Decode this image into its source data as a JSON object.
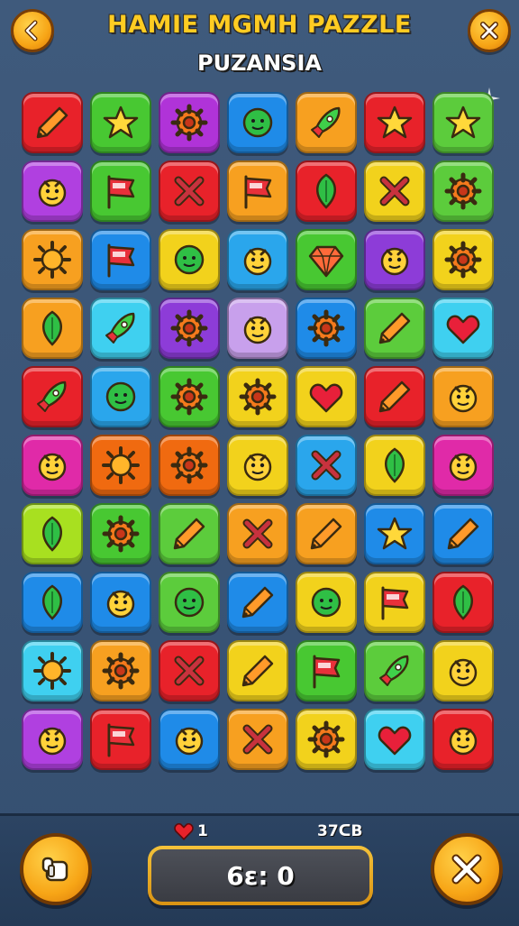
{
  "header": {
    "title": "HAMIE MGMH PAZZLE",
    "subtitle": "PUZANSIA",
    "back_icon": "chevron-left-icon",
    "close_icon": "close-icon"
  },
  "board": {
    "rows": 10,
    "cols": 7,
    "tiles": [
      [
        [
          "#e8222a",
          "crayon"
        ],
        [
          "#48c832",
          "star"
        ],
        [
          "#b033d8",
          "gear"
        ],
        [
          "#1f8be8",
          "blob"
        ],
        [
          "#f7a020",
          "rocket"
        ],
        [
          "#e8222a",
          "star"
        ],
        [
          "#5ccc3c",
          "star"
        ]
      ],
      [
        [
          "#b040e0",
          "creature"
        ],
        [
          "#48c832",
          "flag"
        ],
        [
          "#e8222a",
          "cross"
        ],
        [
          "#f7a020",
          "flag"
        ],
        [
          "#e8222a",
          "leaf"
        ],
        [
          "#f2d21c",
          "cross"
        ],
        [
          "#5ccc3c",
          "gear"
        ]
      ],
      [
        [
          "#f7a020",
          "sun"
        ],
        [
          "#1f8be8",
          "flag"
        ],
        [
          "#f2d21c",
          "blob"
        ],
        [
          "#2aa6ec",
          "creature"
        ],
        [
          "#48c832",
          "gem"
        ],
        [
          "#8d3cd8",
          "creature"
        ],
        [
          "#f2d21c",
          "gear"
        ]
      ],
      [
        [
          "#f7a020",
          "leaf"
        ],
        [
          "#3fd0f0",
          "rocket"
        ],
        [
          "#8d3cd8",
          "gear"
        ],
        [
          "#c8a0ec",
          "creature"
        ],
        [
          "#1f8be8",
          "gear"
        ],
        [
          "#5ccc3c",
          "crayon"
        ],
        [
          "#3fd0f0",
          "heart"
        ]
      ],
      [
        [
          "#e8222a",
          "rocket"
        ],
        [
          "#2aa6ec",
          "blob"
        ],
        [
          "#48c832",
          "gear"
        ],
        [
          "#f2d21c",
          "gear"
        ],
        [
          "#f2d21c",
          "heart"
        ],
        [
          "#e8222a",
          "crayon"
        ],
        [
          "#f7a020",
          "creature"
        ]
      ],
      [
        [
          "#e02aa8",
          "creature"
        ],
        [
          "#f06a10",
          "sun"
        ],
        [
          "#f06a10",
          "gear"
        ],
        [
          "#f2d21c",
          "creature"
        ],
        [
          "#2aa6ec",
          "cross"
        ],
        [
          "#f2d21c",
          "leaf"
        ],
        [
          "#e02aa8",
          "creature"
        ]
      ],
      [
        [
          "#a8e020",
          "leaf"
        ],
        [
          "#48c832",
          "gear"
        ],
        [
          "#5ccc3c",
          "crayon"
        ],
        [
          "#f7a020",
          "cross"
        ],
        [
          "#f7a020",
          "crayon"
        ],
        [
          "#1f8be8",
          "star"
        ],
        [
          "#1f8be8",
          "crayon"
        ]
      ],
      [
        [
          "#1f8be8",
          "leaf"
        ],
        [
          "#1f8be8",
          "creature"
        ],
        [
          "#5ccc3c",
          "blob"
        ],
        [
          "#1f8be8",
          "crayon"
        ],
        [
          "#f2d21c",
          "blob"
        ],
        [
          "#f2d21c",
          "flag"
        ],
        [
          "#e8222a",
          "leaf"
        ]
      ],
      [
        [
          "#3fd0f0",
          "sun"
        ],
        [
          "#f7a020",
          "gear"
        ],
        [
          "#e8222a",
          "cross"
        ],
        [
          "#f2d21c",
          "crayon"
        ],
        [
          "#48c832",
          "flag"
        ],
        [
          "#5ccc3c",
          "rocket"
        ],
        [
          "#f2d21c",
          "creature"
        ]
      ],
      [
        [
          "#b040e0",
          "creature"
        ],
        [
          "#e8222a",
          "flag"
        ],
        [
          "#1f8be8",
          "creature"
        ],
        [
          "#f7a020",
          "cross"
        ],
        [
          "#f2d21c",
          "gear"
        ],
        [
          "#3fd0f0",
          "heart"
        ],
        [
          "#e8222a",
          "creature"
        ]
      ]
    ]
  },
  "footer": {
    "moves_value": "1",
    "moves_icon": "heart-icon",
    "score_value": "37ᑕB",
    "timer_value": "6ɛ: 0",
    "hint_icon": "hand-icon",
    "shuffle_icon": "tools-icon"
  },
  "colors": {
    "accent": "#f7a516",
    "title": "#ffcc22",
    "background": "#3a5577"
  }
}
